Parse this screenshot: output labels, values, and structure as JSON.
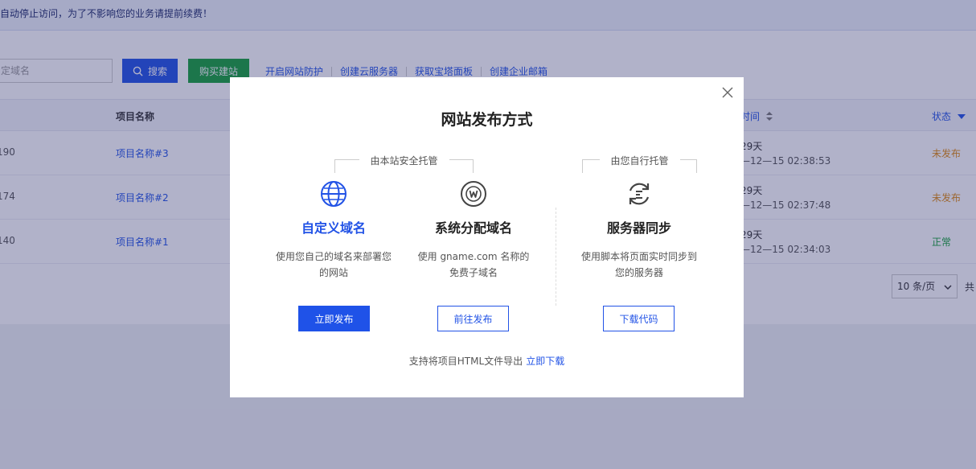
{
  "notice": {
    "text": "自动停止访问，为了不影响您的业务请提前续费！"
  },
  "toolbar": {
    "search_placeholder": "定域名",
    "search_label": "搜索",
    "buy_label": "购买建站",
    "links": [
      "开启网站防护",
      "创建云服务器",
      "获取宝塔面板",
      "创建企业邮箱"
    ]
  },
  "table": {
    "columns": {
      "name": "项目名称",
      "time": "时间",
      "status": "状态"
    },
    "rows": [
      {
        "id": "190",
        "name": "项目名称#3",
        "days": "29天",
        "time": "—12—15 02:38:53",
        "status": "未发布",
        "status_color": "#e08a12"
      },
      {
        "id": "174",
        "name": "项目名称#2",
        "days": "29天",
        "time": "—12—15 02:37:48",
        "status": "未发布",
        "status_color": "#e08a12"
      },
      {
        "id": "140",
        "name": "项目名称#1",
        "days": "29天",
        "time": "—12—15 02:34:03",
        "status": "正常",
        "status_color": "#17a23a"
      }
    ]
  },
  "pager": {
    "page_size": "10 条/页",
    "total_prefix": "共"
  },
  "modal": {
    "title": "网站发布方式",
    "group_hosted": "由本站安全托管",
    "group_self": "由您自行托管",
    "options": [
      {
        "icon": "globe-icon",
        "title": "自定义域名",
        "desc": "使用您自己的域名来部署您的网站",
        "button": "立即发布"
      },
      {
        "icon": "web-globe-icon",
        "title": "系统分配域名",
        "desc": "使用 gname.com 名称的免费子域名",
        "button": "前往发布"
      },
      {
        "icon": "sync-icon",
        "title": "服务器同步",
        "desc": "使用脚本将页面实时同步到您的服务器",
        "button": "下载代码"
      }
    ],
    "footer_text": "支持将项目HTML文件导出",
    "footer_link": "立即下载"
  },
  "colors": {
    "accent": "#2253e6",
    "pending": "#e08a12",
    "ok": "#17a23a",
    "overlay": "rgba(38,41,104,0.36)"
  }
}
